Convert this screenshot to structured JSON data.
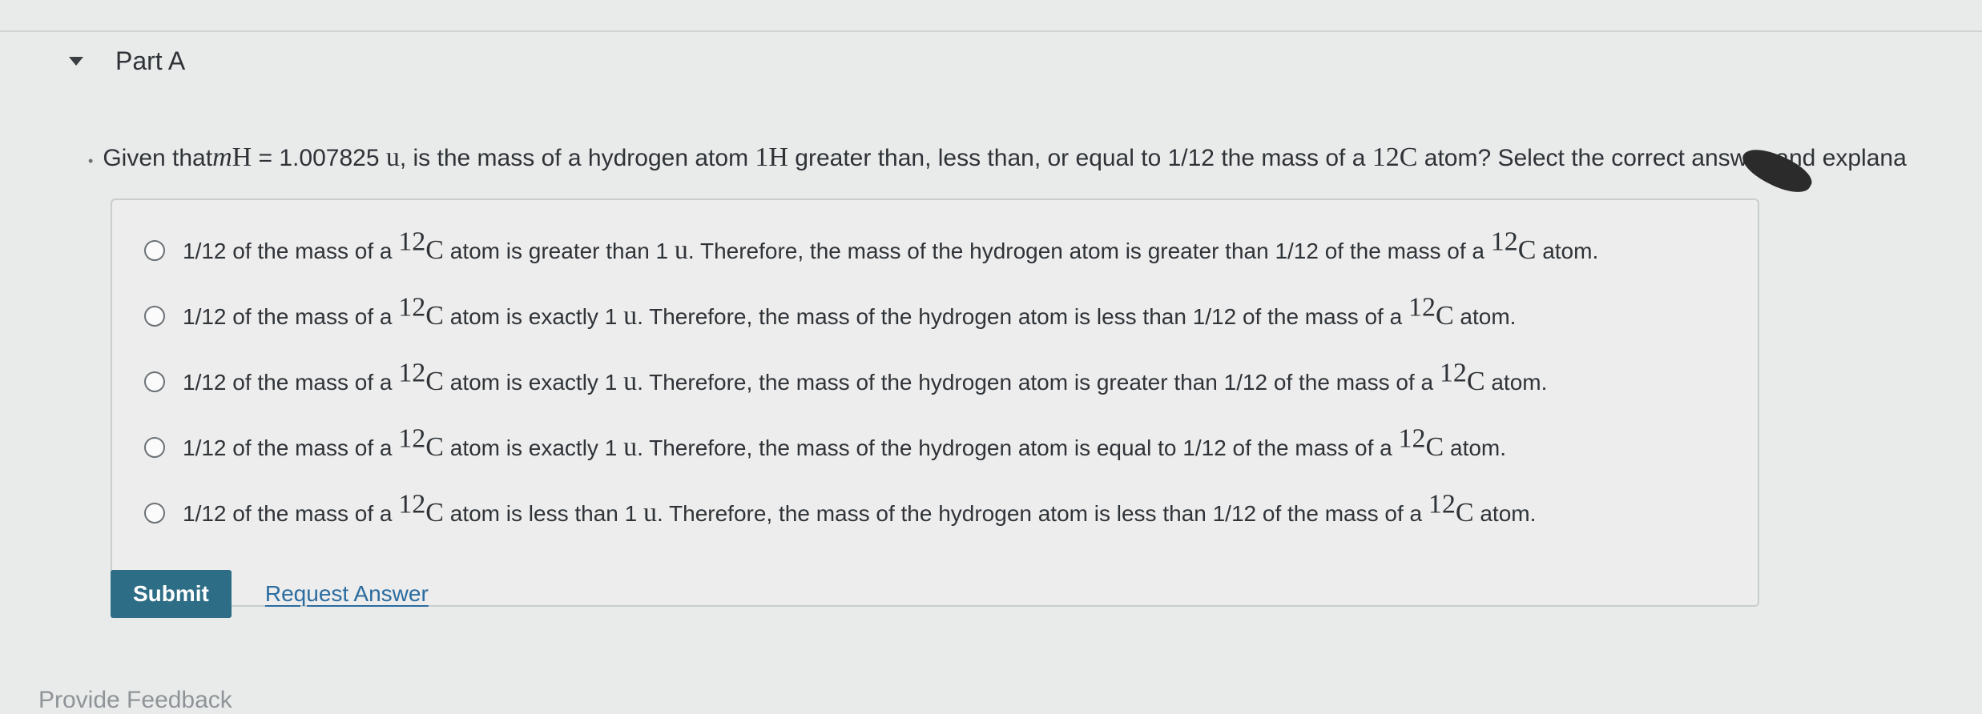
{
  "part": {
    "title": "Part A"
  },
  "question": {
    "lead": "Given that ",
    "m_symbol": "m",
    "m_subscript": "H",
    "value_text": " = 1.007825 ",
    "unit": "u",
    "mid_text": ", is the mass of a hydrogen atom ",
    "h_superscript": "1",
    "h_symbol": "H",
    "after_h": " greater than, less than, or equal to 1/12 the mass of a ",
    "c_superscript": "12",
    "c_symbol": "C",
    "tail": " atom? Select the correct answer and explana"
  },
  "options": [
    {
      "a": "1/12 of the mass of a ",
      "sup1": "12",
      "sym1": "C",
      "b": " atom is greater than 1 ",
      "unit": "u",
      "c": ". Therefore, the mass of the hydrogen atom is greater than 1/12 of the mass of a ",
      "sup2": "12",
      "sym2": "C",
      "d": " atom."
    },
    {
      "a": "1/12 of the mass of a ",
      "sup1": "12",
      "sym1": "C",
      "b": " atom is exactly 1 ",
      "unit": "u",
      "c": ". Therefore, the mass of the hydrogen atom is less than 1/12 of the mass of a ",
      "sup2": "12",
      "sym2": "C",
      "d": " atom."
    },
    {
      "a": "1/12 of the mass of a ",
      "sup1": "12",
      "sym1": "C",
      "b": " atom is exactly 1 ",
      "unit": "u",
      "c": ". Therefore, the mass of the hydrogen atom is greater than 1/12 of the mass of a ",
      "sup2": "12",
      "sym2": "C",
      "d": " atom."
    },
    {
      "a": "1/12 of the mass of a ",
      "sup1": "12",
      "sym1": "C",
      "b": " atom is exactly 1 ",
      "unit": "u",
      "c": ". Therefore, the mass of the hydrogen atom is equal to 1/12 of the mass of a ",
      "sup2": "12",
      "sym2": "C",
      "d": " atom."
    },
    {
      "a": "1/12 of the mass of a ",
      "sup1": "12",
      "sym1": "C",
      "b": " atom is less than 1 ",
      "unit": "u",
      "c": ". Therefore, the mass of the hydrogen atom is less than 1/12 of the mass of a ",
      "sup2": "12",
      "sym2": "C",
      "d": " atom."
    }
  ],
  "actions": {
    "submit_label": "Submit",
    "request_label": "Request Answer"
  },
  "footer": {
    "feedback_label": "Provide Feedback"
  },
  "colors": {
    "submit_bg": "#2d6d86",
    "link": "#2b6ca0"
  },
  "icons": {
    "collapse": "caret-down-icon"
  }
}
